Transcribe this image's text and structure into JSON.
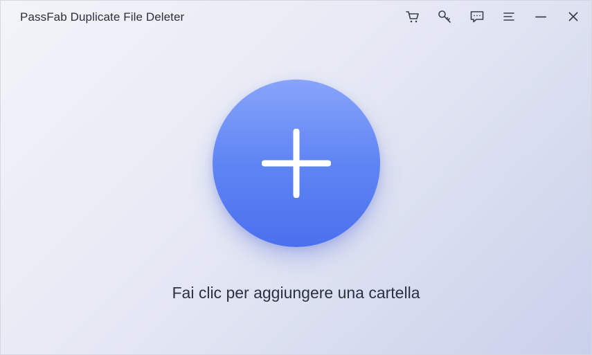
{
  "app": {
    "title": "PassFab Duplicate File Deleter"
  },
  "toolbar": {
    "icons": [
      "cart-icon",
      "key-icon",
      "feedback-icon",
      "menu-icon",
      "minimize-icon",
      "close-icon"
    ]
  },
  "main": {
    "prompt": "Fai clic per aggiungere una cartella",
    "add_icon": "plus-icon"
  },
  "colors": {
    "accent": "#5f85f4",
    "text": "#2a3142",
    "icon": "#3a3f4c"
  }
}
